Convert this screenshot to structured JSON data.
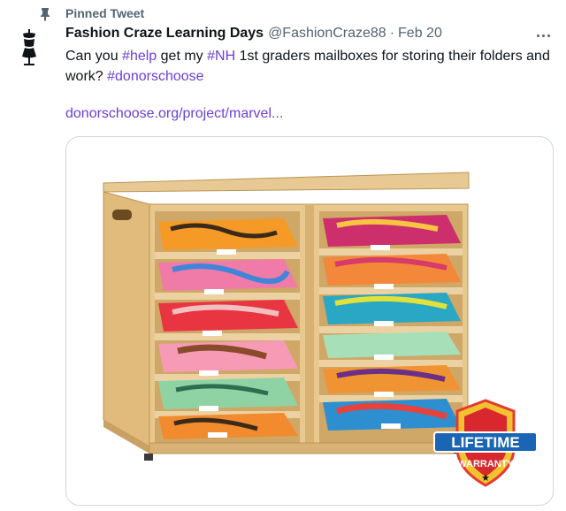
{
  "pinned": {
    "label": "Pinned Tweet"
  },
  "tweet": {
    "author_name": "Fashion Craze Learning Days",
    "handle": "@FashionCraze88",
    "separator": "·",
    "date": "Feb 20",
    "text_parts": [
      {
        "text": "Can you ",
        "kind": "plain"
      },
      {
        "text": "#help",
        "kind": "hashtag"
      },
      {
        "text": " get my ",
        "kind": "plain"
      },
      {
        "text": "#NH",
        "kind": "hashtag"
      },
      {
        "text": " 1st graders mailboxes for storing their folders and work? ",
        "kind": "plain"
      },
      {
        "text": "#donorschoose",
        "kind": "hashtag"
      }
    ],
    "link": "donorschoose.org/project/marvel...",
    "media": {
      "badge_line1": "LIFETIME",
      "badge_line2": "WARRANTY",
      "badge_star": "★"
    }
  },
  "colors": {
    "accent": "#1d9bf0",
    "link": "#6b3fd6",
    "muted": "#536471",
    "wood": "#e4c28b"
  },
  "icons": {
    "pin": "pin-icon",
    "more": "more-icon",
    "avatar": "dress-form-logo"
  }
}
